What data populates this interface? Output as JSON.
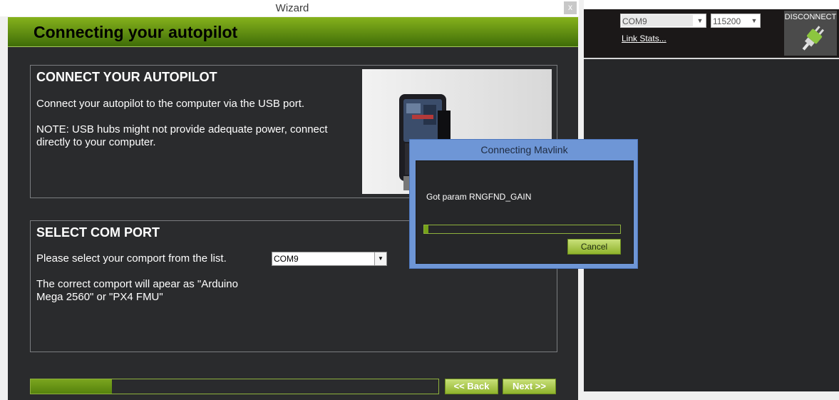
{
  "wizard": {
    "title": "Wizard",
    "close_label": "x",
    "header_title": "Connecting your autopilot",
    "connect_panel": {
      "heading": "CONNECT YOUR AUTOPILOT",
      "text1": "Connect your autopilot to the computer via the USB port.",
      "text2": "NOTE: USB hubs might not provide adequate power, connect directly to your computer."
    },
    "com_panel": {
      "heading": "SELECT COM PORT",
      "prompt": "Please select your comport from the list.",
      "selected_port": "COM9",
      "note": "The correct comport will apear as \"Arduino Mega 2560\" or \"PX4 FMU\""
    },
    "progress_fraction": 0.2,
    "back_label": "<< Back",
    "next_label": "Next >>"
  },
  "toolbar": {
    "port": "COM9",
    "baud": "115200",
    "link_stats": "Link Stats...",
    "disconnect_label": "DISCONNECT"
  },
  "mavlink_dialog": {
    "title": "Connecting Mavlink",
    "status": "Got param RNGFND_GAIN",
    "progress_fraction": 0.02,
    "cancel_label": "Cancel"
  },
  "icons": {
    "plug": "plug-icon",
    "dropdown": "chevron-down-icon"
  },
  "colors": {
    "accent_green": "#76a21a",
    "dialog_blue": "#6e96d6",
    "background_dark": "#2a2b2d"
  }
}
